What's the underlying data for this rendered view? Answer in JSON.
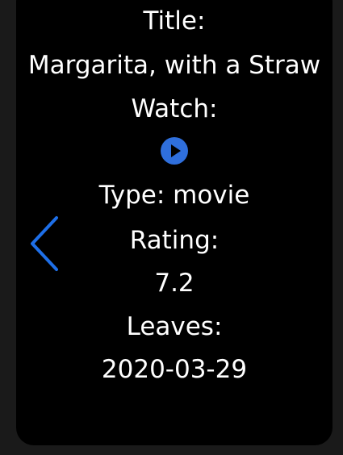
{
  "details": {
    "title_label": "Title:",
    "title_value": "Margarita, with a Straw",
    "watch_label": "Watch:",
    "type_text": "Type: movie",
    "rating_label": "Rating:",
    "rating_value": "7.2",
    "leaves_label": "Leaves:",
    "leaves_value": "2020-03-29"
  },
  "icons": {
    "play": "play-circle-icon",
    "back": "chevron-left-icon"
  },
  "colors": {
    "accent": "#2f6fdc",
    "background": "#000000",
    "text": "#ffffff"
  }
}
